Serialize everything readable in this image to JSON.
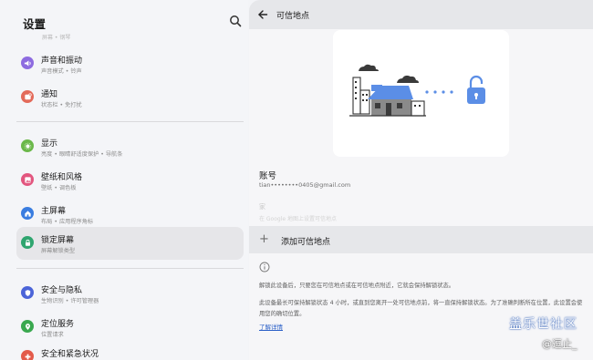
{
  "left": {
    "title": "设置",
    "scroll_hint": "屏幕 • 钢琴",
    "items": [
      {
        "label": "声音和振动",
        "sub": "声音模式 • 铃声",
        "color": "#8d6be0"
      },
      {
        "label": "通知",
        "sub": "状态栏 • 免打扰",
        "color": "#e36a5a"
      },
      {
        "label": "显示",
        "sub": "亮度 • 眼睛舒适度保护 • 导航条",
        "color": "#6bb84a"
      },
      {
        "label": "壁纸和风格",
        "sub": "壁纸 • 调色板",
        "color": "#e2567f"
      },
      {
        "label": "主屏幕",
        "sub": "布局 • 应用程序角标",
        "color": "#3a7de0"
      },
      {
        "label": "锁定屏幕",
        "sub": "屏幕解锁类型",
        "color": "#2fa56f"
      },
      {
        "label": "安全与隐私",
        "sub": "生物识别 • 许可管理器",
        "color": "#4b64d8"
      },
      {
        "label": "定位服务",
        "sub": "位置请求",
        "color": "#3aa84f"
      },
      {
        "label": "安全和紧急状况",
        "sub": "",
        "color": "#e35a4a"
      }
    ]
  },
  "right": {
    "header_title": "可信地点",
    "account_title": "账号",
    "account_email": "tian••••••••0405@gmail.com",
    "home_label": "家",
    "home_sub": "在 Google 地图上设置可信地点",
    "add_label": "添加可信地点",
    "para1": "解锁此设备后，只要您在可信地点或在可信地点附近，它就会保持解锁状态。",
    "para2": "此设备最长可保持解锁状态 4 小时，或直到您离开一处可信地点前，将一直保持解锁状态。为了准确判断所在位置，此设置会使用您的确切位置。",
    "link": "了解详情"
  },
  "watermark": {
    "line1": "盖乐世社区",
    "line2": "@逗止_"
  },
  "colors": {
    "accent": "#5b8ee6",
    "link": "#2a5fc7"
  }
}
